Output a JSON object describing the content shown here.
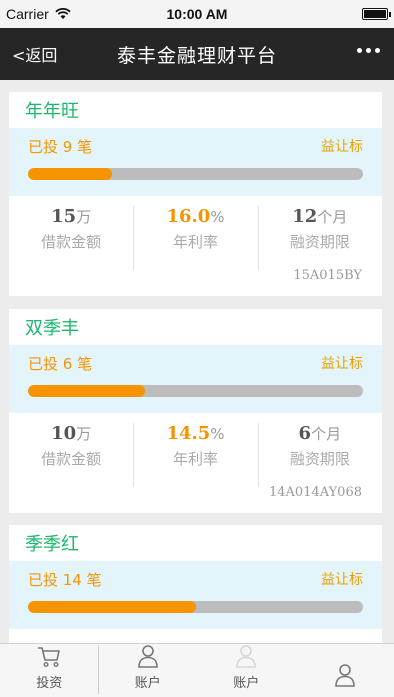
{
  "status_bar": {
    "carrier": "Carrier",
    "time": "10:00 AM"
  },
  "nav": {
    "back_label": "<返回",
    "title": "泰丰金融理财平台"
  },
  "products": [
    {
      "name": "年年旺",
      "invest_count": "已投 9 笔",
      "tag": "益让标",
      "progress": 0.25,
      "amount": "15",
      "amount_unit": "万",
      "amount_label": "借款金额",
      "rate": "16.0",
      "rate_unit": "%",
      "rate_label": "年利率",
      "term": "12",
      "term_unit": "个月",
      "term_label": "融资期限",
      "code": "15A015BY"
    },
    {
      "name": "双季丰",
      "invest_count": "已投 6 笔",
      "tag": "益让标",
      "progress": 0.35,
      "amount": "10",
      "amount_unit": "万",
      "amount_label": "借款金额",
      "rate": "14.5",
      "rate_unit": "%",
      "rate_label": "年利率",
      "term": "6",
      "term_unit": "个月",
      "term_label": "融资期限",
      "code": "14A014AY068"
    },
    {
      "name": "季季红",
      "invest_count": "已投 14 笔",
      "tag": "益让标",
      "progress": 0.5
    }
  ],
  "tabs": [
    {
      "label": "投资",
      "icon": "cart-icon"
    },
    {
      "label": "账户",
      "icon": "user-icon"
    },
    {
      "label": "账户",
      "icon": "user-icon"
    },
    {
      "label": "",
      "icon": "user-icon"
    }
  ],
  "colors": {
    "accent_green": "#19b86b",
    "accent_orange": "#f29500",
    "progress_track": "#bcbcbc",
    "progress_area": "#e4f4fb",
    "navbar": "#262626"
  }
}
